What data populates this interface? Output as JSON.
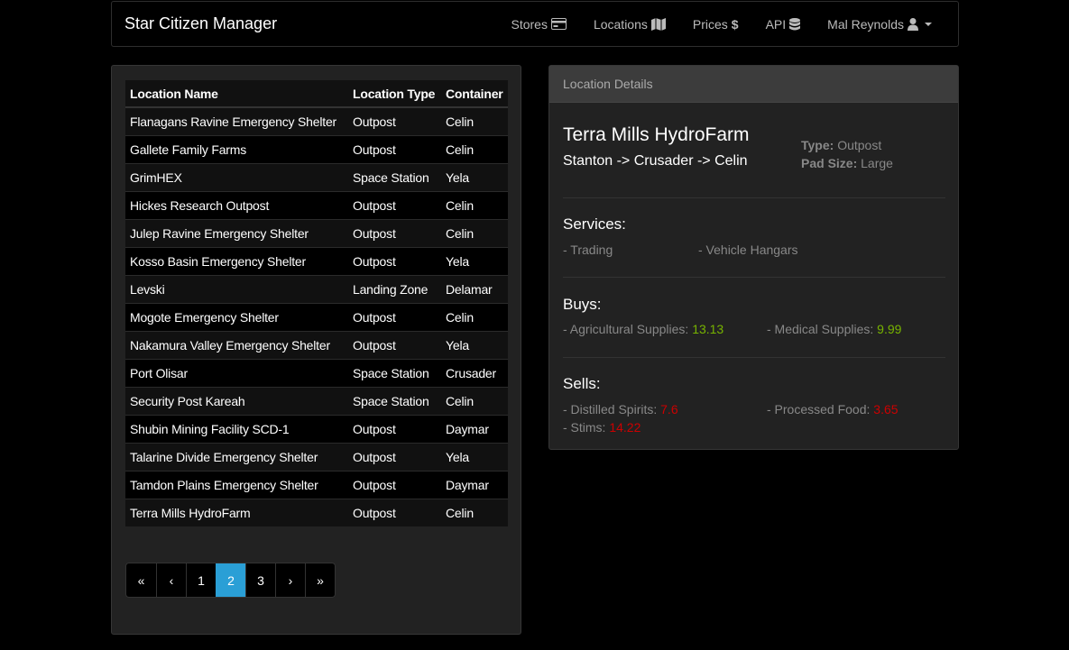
{
  "nav": {
    "brand": "Star Citizen Manager",
    "items": [
      {
        "label": "Stores",
        "icon": "credit-card-icon"
      },
      {
        "label": "Locations",
        "icon": "map-icon"
      },
      {
        "label": "Prices",
        "icon": "dollar-icon"
      },
      {
        "label": "API",
        "icon": "database-icon"
      }
    ],
    "user": {
      "label": "Mal Reynolds",
      "icon": "user-icon"
    }
  },
  "table": {
    "headers": [
      "Location Name",
      "Location Type",
      "Container"
    ],
    "rows": [
      [
        "Flanagans Ravine Emergency Shelter",
        "Outpost",
        "Celin"
      ],
      [
        "Gallete Family Farms",
        "Outpost",
        "Celin"
      ],
      [
        "GrimHEX",
        "Space Station",
        "Yela"
      ],
      [
        "Hickes Research Outpost",
        "Outpost",
        "Celin"
      ],
      [
        "Julep Ravine Emergency Shelter",
        "Outpost",
        "Celin"
      ],
      [
        "Kosso Basin Emergency Shelter",
        "Outpost",
        "Yela"
      ],
      [
        "Levski",
        "Landing Zone",
        "Delamar"
      ],
      [
        "Mogote Emergency Shelter",
        "Outpost",
        "Celin"
      ],
      [
        "Nakamura Valley Emergency Shelter",
        "Outpost",
        "Yela"
      ],
      [
        "Port Olisar",
        "Space Station",
        "Crusader"
      ],
      [
        "Security Post Kareah",
        "Space Station",
        "Celin"
      ],
      [
        "Shubin Mining Facility SCD-1",
        "Outpost",
        "Daymar"
      ],
      [
        "Talarine Divide Emergency Shelter",
        "Outpost",
        "Yela"
      ],
      [
        "Tamdon Plains Emergency Shelter",
        "Outpost",
        "Daymar"
      ],
      [
        "Terra Mills HydroFarm",
        "Outpost",
        "Celin"
      ]
    ]
  },
  "pagination": {
    "first": "«",
    "prev": "‹",
    "pages": [
      "1",
      "2",
      "3"
    ],
    "active": "2",
    "next": "›",
    "last": "»"
  },
  "details": {
    "heading": "Location Details",
    "name": "Terra Mills HydroFarm",
    "path": "Stanton -> Crusader -> Celin",
    "type_label": "Type:",
    "type_value": "Outpost",
    "pad_label": "Pad Size:",
    "pad_value": "Large",
    "services_title": "Services:",
    "services": [
      "- Trading",
      "- Vehicle Hangars"
    ],
    "buys_title": "Buys:",
    "buys": [
      {
        "label": "- Agricultural Supplies:",
        "value": "13.13"
      },
      {
        "label": "- Medical Supplies:",
        "value": "9.99"
      }
    ],
    "sells_title": "Sells:",
    "sells": [
      {
        "label": "- Distilled Spirits:",
        "value": "7.6"
      },
      {
        "label": "- Processed Food:",
        "value": "3.65"
      },
      {
        "label": "- Stims:",
        "value": "14.22"
      }
    ]
  },
  "colors": {
    "accent": "#2a9fd6",
    "buy_price": "#77b300",
    "sell_price": "#cc0000"
  }
}
